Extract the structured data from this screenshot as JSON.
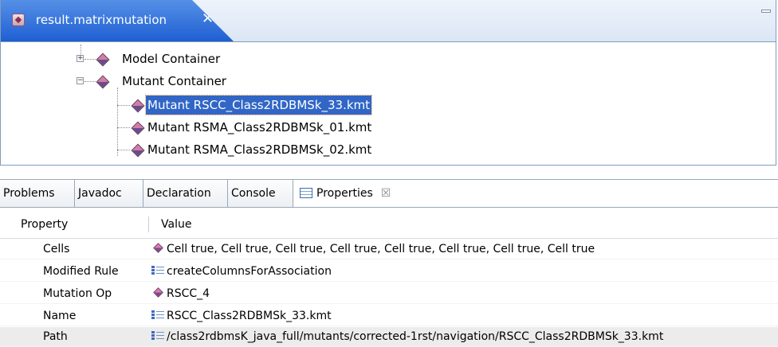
{
  "editor": {
    "tab_title": "result.matrixmutation",
    "close_glyph": "✕",
    "tree": [
      {
        "label": "Model Container",
        "expander": "+"
      },
      {
        "label": "Mutant Container",
        "expander": "−"
      },
      {
        "label": "Mutant RSCC_Class2RDBMSk_33.kmt",
        "selected": true
      },
      {
        "label": "Mutant RSMA_Class2RDBMSk_01.kmt"
      },
      {
        "label": "Mutant RSMA_Class2RDBMSk_02.kmt"
      }
    ]
  },
  "views": {
    "tabs": [
      {
        "label": "Problems"
      },
      {
        "label": "Javadoc"
      },
      {
        "label": "Declaration"
      },
      {
        "label": "Console"
      },
      {
        "label": "Properties",
        "active": true
      }
    ],
    "close_glyph": "☒"
  },
  "properties": {
    "header": {
      "property": "Property",
      "value": "Value"
    },
    "rows": [
      {
        "name": "Cells",
        "icon": "diamond-icon",
        "value": "Cell true, Cell true, Cell true, Cell true, Cell true, Cell true, Cell true, Cell true"
      },
      {
        "name": "Modified Rule",
        "icon": "list-icon",
        "value": "createColumnsForAssociation"
      },
      {
        "name": "Mutation Op",
        "icon": "diamond-icon",
        "value": "RSCC_4"
      },
      {
        "name": "Name",
        "icon": "list-icon",
        "value": "RSCC_Class2RDBMSk_33.kmt"
      },
      {
        "name": "Path",
        "icon": "list-icon",
        "value": "/class2rdbmsK_java_full/mutants/corrected-1rst/navigation/RSCC_Class2RDBMSk_33.kmt"
      }
    ]
  }
}
